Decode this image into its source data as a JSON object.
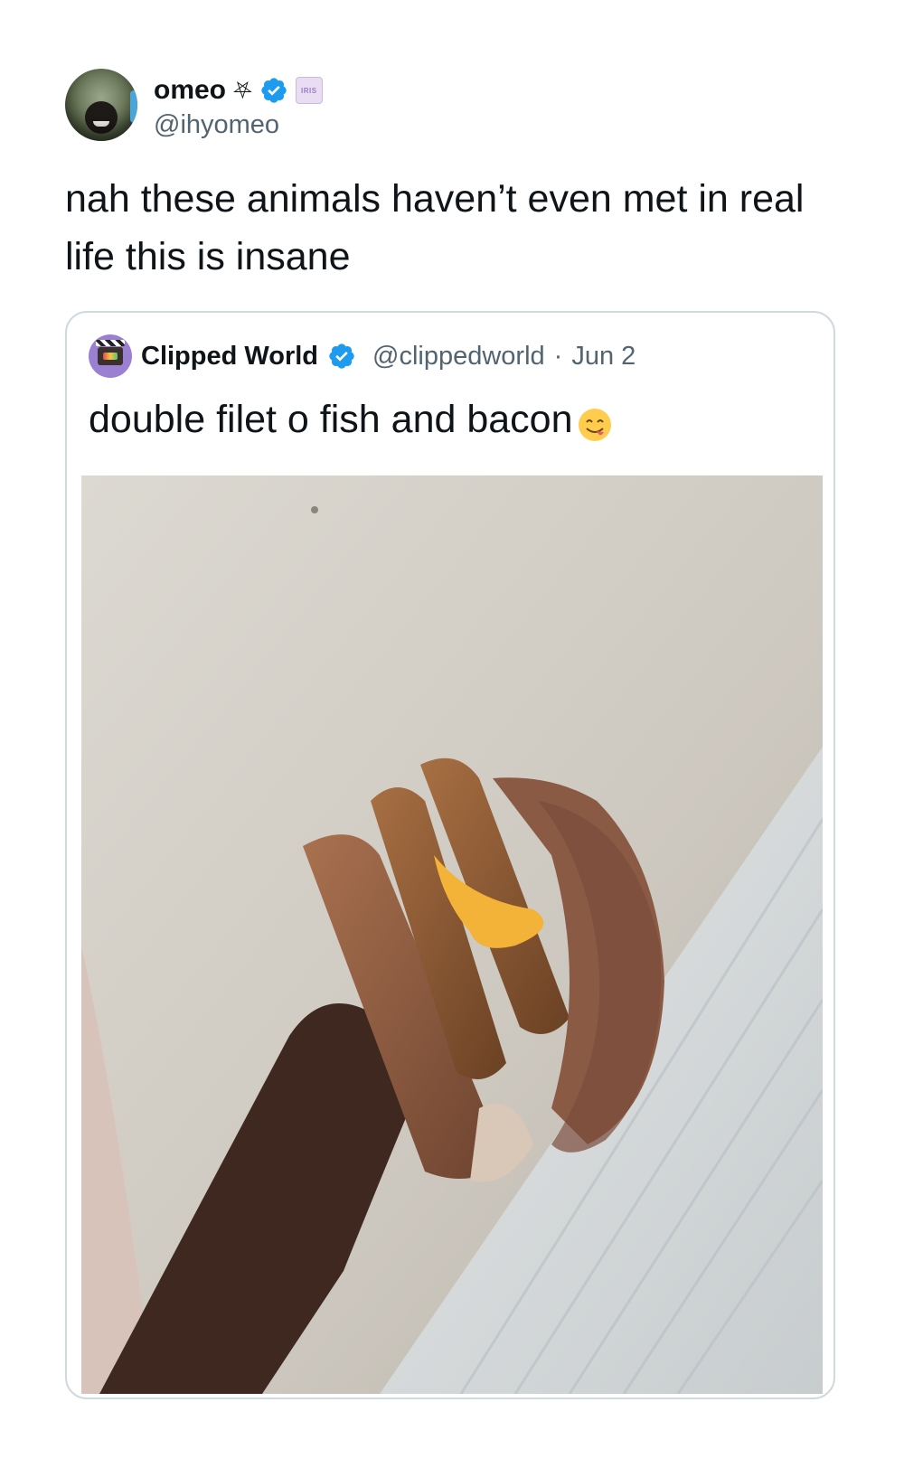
{
  "tweet": {
    "author": {
      "display_name": "omeo",
      "handle": "@ihyomeo",
      "name_symbol": "⛧",
      "verified": true,
      "affiliate_badge_text": "IRIS"
    },
    "text": "nah these animals haven’t even met in real life this is insane"
  },
  "quoted_tweet": {
    "author": {
      "display_name": "Clipped World",
      "handle": "@clippedworld",
      "verified": true
    },
    "separator": "·",
    "date": "Jun 2",
    "text": "double filet o fish and bacon",
    "emoji": "face-savoring-food-icon",
    "media": {
      "type": "photo",
      "subject": "hand holding sandwich"
    }
  },
  "colors": {
    "verified_blue": "#1d9bf0",
    "secondary_text": "#536471",
    "card_border": "#cfd9de"
  }
}
